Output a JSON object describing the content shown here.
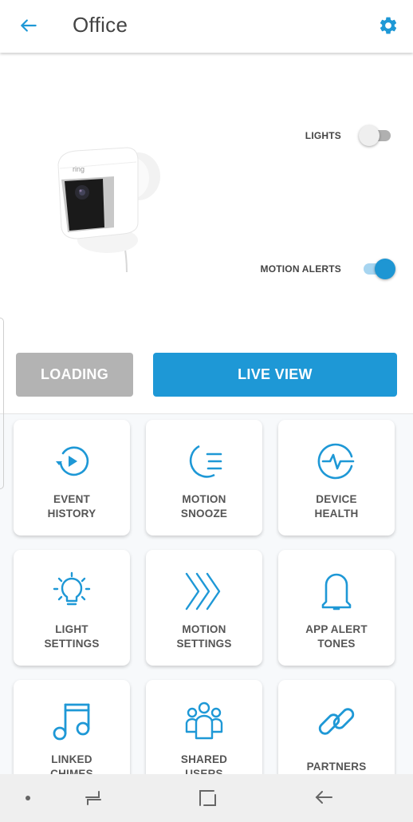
{
  "header": {
    "title": "Office",
    "back_icon": "arrow-left-icon",
    "settings_icon": "gear-icon"
  },
  "device": {
    "image": "spotlight-camera",
    "brand_mark": "ring"
  },
  "toggles": [
    {
      "label": "LIGHTS",
      "state": "off"
    },
    {
      "label": "MOTION ALERTS",
      "state": "on"
    }
  ],
  "actions": {
    "loading_label": "LOADING",
    "live_view_label": "LIVE VIEW"
  },
  "tiles": [
    {
      "line1": "EVENT",
      "line2": "HISTORY",
      "icon": "history-play-icon"
    },
    {
      "line1": "MOTION",
      "line2": "SNOOZE",
      "icon": "moon-snooze-icon"
    },
    {
      "line1": "DEVICE",
      "line2": "HEALTH",
      "icon": "heartbeat-icon"
    },
    {
      "line1": "LIGHT",
      "line2": "SETTINGS",
      "icon": "lightbulb-icon"
    },
    {
      "line1": "MOTION",
      "line2": "SETTINGS",
      "icon": "chevrons-right-icon"
    },
    {
      "line1": "APP ALERT",
      "line2": "TONES",
      "icon": "bell-icon"
    },
    {
      "line1": "LINKED",
      "line2": "CHIMES",
      "icon": "music-note-icon"
    },
    {
      "line1": "SHARED",
      "line2": "USERS",
      "icon": "users-icon"
    },
    {
      "line1": "PARTNERS",
      "line2": "",
      "icon": "link-icon"
    }
  ],
  "colors": {
    "accent": "#1e98d6",
    "loading_button": "#b3b3b3",
    "text": "#444444",
    "nav_bar": "#efefef"
  },
  "system_nav": {
    "items": [
      "dot",
      "recents",
      "home",
      "back"
    ]
  }
}
